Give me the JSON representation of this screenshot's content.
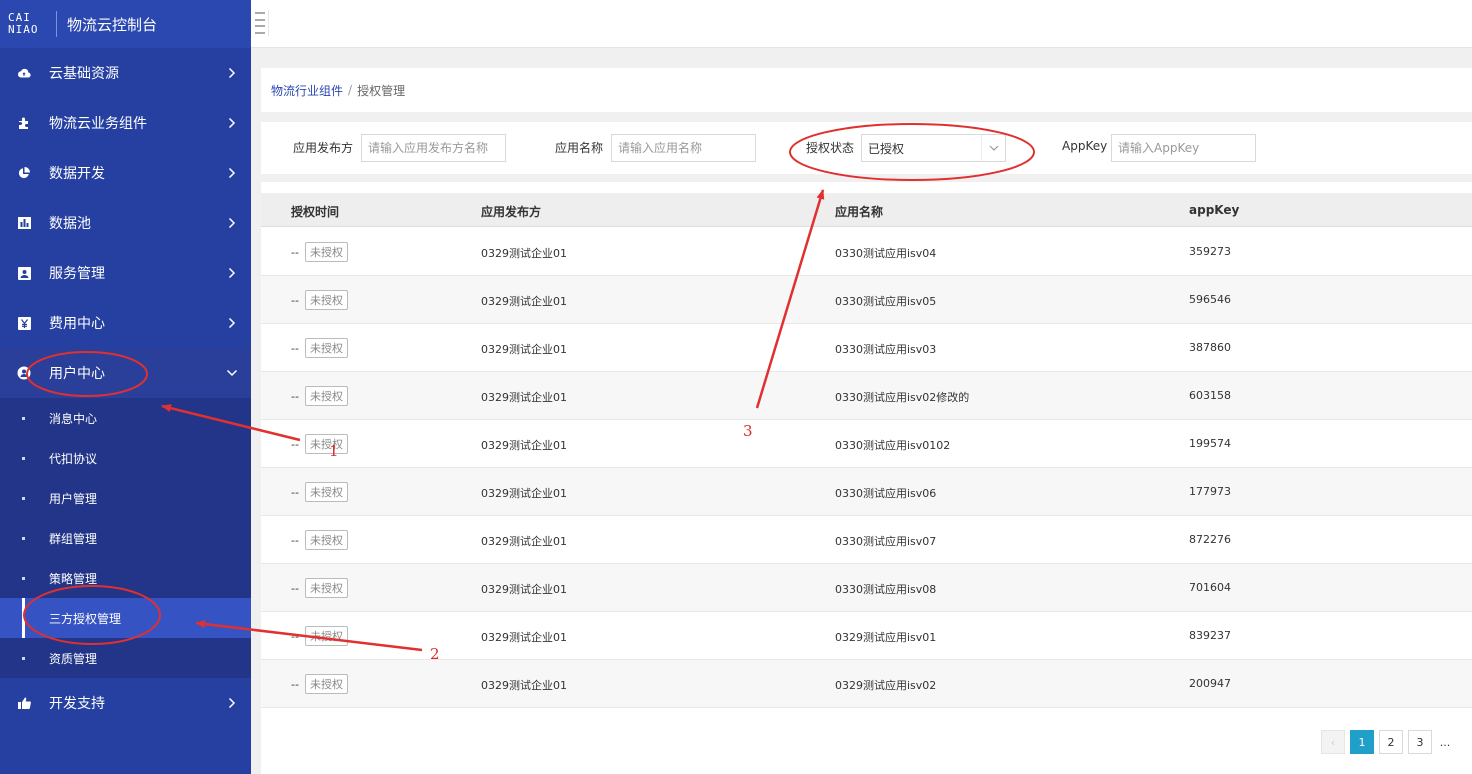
{
  "brand": {
    "logo_line1": "CAI",
    "logo_line2": "NIAO",
    "title": "物流云控制台"
  },
  "sidebar": {
    "items": [
      {
        "label": "云基础资源",
        "icon": "cloud-icon"
      },
      {
        "label": "物流云业务组件",
        "icon": "puzzle-icon"
      },
      {
        "label": "数据开发",
        "icon": "pie-chart-icon"
      },
      {
        "label": "数据池",
        "icon": "bar-chart-icon"
      },
      {
        "label": "服务管理",
        "icon": "service-icon"
      },
      {
        "label": "费用中心",
        "icon": "yen-icon"
      },
      {
        "label": "用户中心",
        "icon": "user-icon"
      },
      {
        "label": "开发支持",
        "icon": "thumbs-up-icon"
      }
    ],
    "submenu": [
      "消息中心",
      "代扣协议",
      "用户管理",
      "群组管理",
      "策略管理",
      "三方授权管理",
      "资质管理"
    ],
    "active_sub": "三方授权管理"
  },
  "breadcrumb": {
    "parent": "物流行业组件",
    "separator": "/",
    "current": "授权管理"
  },
  "filters": {
    "publisher_label": "应用发布方",
    "publisher_placeholder": "请输入应用发布方名称",
    "appname_label": "应用名称",
    "appname_placeholder": "请输入应用名称",
    "status_label": "授权状态",
    "status_value": "已授权",
    "appkey_label": "AppKey",
    "appkey_placeholder": "请输入AppKey"
  },
  "table": {
    "headers": [
      "授权时间",
      "应用发布方",
      "应用名称",
      "appKey"
    ],
    "rows": [
      {
        "time": "--",
        "badge": "未授权",
        "publisher": "0329测试企业01",
        "app": "0330测试应用isv04",
        "key": "359273"
      },
      {
        "time": "--",
        "badge": "未授权",
        "publisher": "0329测试企业01",
        "app": "0330测试应用isv05",
        "key": "596546"
      },
      {
        "time": "--",
        "badge": "未授权",
        "publisher": "0329测试企业01",
        "app": "0330测试应用isv03",
        "key": "387860"
      },
      {
        "time": "--",
        "badge": "未授权",
        "publisher": "0329测试企业01",
        "app": "0330测试应用isv02修改的",
        "key": "603158"
      },
      {
        "time": "--",
        "badge": "未授权",
        "publisher": "0329测试企业01",
        "app": "0330测试应用isv0102",
        "key": "199574"
      },
      {
        "time": "--",
        "badge": "未授权",
        "publisher": "0329测试企业01",
        "app": "0330测试应用isv06",
        "key": "177973"
      },
      {
        "time": "--",
        "badge": "未授权",
        "publisher": "0329测试企业01",
        "app": "0330测试应用isv07",
        "key": "872276"
      },
      {
        "time": "--",
        "badge": "未授权",
        "publisher": "0329测试企业01",
        "app": "0330测试应用isv08",
        "key": "701604"
      },
      {
        "time": "--",
        "badge": "未授权",
        "publisher": "0329测试企业01",
        "app": "0329测试应用isv01",
        "key": "839237"
      },
      {
        "time": "--",
        "badge": "未授权",
        "publisher": "0329测试企业01",
        "app": "0329测试应用isv02",
        "key": "200947"
      }
    ]
  },
  "pagination": {
    "prev": "‹",
    "pages": [
      "1",
      "2",
      "3"
    ],
    "ellipsis": "...",
    "current": "1"
  },
  "annotations": {
    "n1": "1",
    "n2": "2",
    "n3": "3",
    "color": "#d92b2b"
  },
  "colors": {
    "sidebar_bg": "#2640a1",
    "active_sub_bg": "#3653c4",
    "accent": "#20a0c9",
    "brand_link": "#2b47b0"
  }
}
